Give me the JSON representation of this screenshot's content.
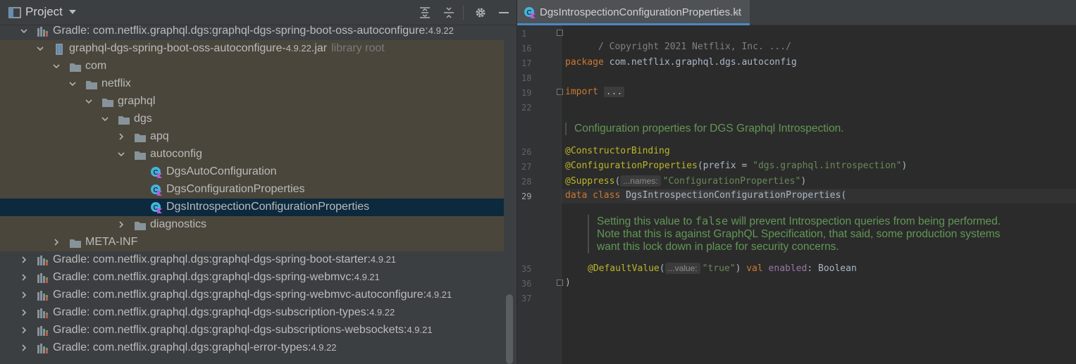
{
  "project": {
    "title": "Project",
    "tree": [
      {
        "label": "Gradle: com.netflix.graphql.dgs:graphql-dgs-spring-boot-oss-autoconfigure:",
        "version": "4.9.22",
        "expanded": true,
        "icon": "library-icon"
      },
      {
        "label": "graphql-dgs-spring-boot-oss-autoconfigure-",
        "version": "4.9.22",
        "suffix": ".jar",
        "hint": "library root",
        "expanded": true,
        "icon": "jar-icon"
      },
      {
        "label": "com",
        "expanded": true,
        "icon": "folder-icon"
      },
      {
        "label": "netflix",
        "expanded": true,
        "icon": "folder-icon"
      },
      {
        "label": "graphql",
        "expanded": true,
        "icon": "folder-icon"
      },
      {
        "label": "dgs",
        "expanded": true,
        "icon": "folder-icon"
      },
      {
        "label": "apq",
        "expanded": false,
        "icon": "folder-icon"
      },
      {
        "label": "autoconfig",
        "expanded": true,
        "icon": "folder-icon"
      },
      {
        "label": "DgsAutoConfiguration",
        "icon": "kotlin-class-icon"
      },
      {
        "label": "DgsConfigurationProperties",
        "icon": "kotlin-class-icon"
      },
      {
        "label": "DgsIntrospectionConfigurationProperties",
        "icon": "kotlin-class-icon",
        "selected": true
      },
      {
        "label": "diagnostics",
        "expanded": false,
        "icon": "folder-icon"
      },
      {
        "label": "META-INF",
        "expanded": false,
        "icon": "folder-icon"
      },
      {
        "label": "Gradle: com.netflix.graphql.dgs:graphql-dgs-spring-boot-starter:",
        "version": "4.9.21",
        "expanded": false,
        "icon": "library-icon"
      },
      {
        "label": "Gradle: com.netflix.graphql.dgs:graphql-dgs-spring-webmvc:",
        "version": "4.9.21",
        "expanded": false,
        "icon": "library-icon"
      },
      {
        "label": "Gradle: com.netflix.graphql.dgs:graphql-dgs-spring-webmvc-autoconfigure:",
        "version": "4.9.21",
        "expanded": false,
        "icon": "library-icon"
      },
      {
        "label": "Gradle: com.netflix.graphql.dgs:graphql-dgs-subscription-types:",
        "version": "4.9.22",
        "expanded": false,
        "icon": "library-icon"
      },
      {
        "label": "Gradle: com.netflix.graphql.dgs:graphql-dgs-subscriptions-websockets:",
        "version": "4.9.21",
        "expanded": false,
        "icon": "library-icon"
      },
      {
        "label": "Gradle: com.netflix.graphql.dgs:graphql-error-types:",
        "version": "4.9.22",
        "expanded": false,
        "icon": "library-icon"
      }
    ]
  },
  "editor": {
    "tab_label": "DgsIntrospectionConfigurationProperties.kt",
    "tab_close": "×",
    "line_numbers": [
      "1",
      "16",
      "17",
      "18",
      "19",
      "22",
      "26",
      "27",
      "28",
      "29",
      "35",
      "36",
      "37"
    ],
    "current_line": "29",
    "code": {
      "copyright": "/ Copyright 2021 Netflix, Inc. .../",
      "package_kw": "package",
      "package_name": " com.netflix.graphql.dgs.autoconfig",
      "import_kw": "import",
      "import_fold": "...",
      "doc1": "Configuration properties for DGS Graphql Introspection.",
      "ann1": "@ConstructorBinding",
      "ann2": "@ConfigurationProperties",
      "ann2_args_open": "(prefix = ",
      "ann2_str": "\"dgs.graphql.introspection\"",
      "ann2_close": ")",
      "ann3": "@Suppress",
      "ann3_open": "(",
      "ann3_hint": "...names:",
      "ann3_str": "\"ConfigurationProperties\"",
      "ann3_close": ")",
      "data_kw": "data class ",
      "class_name": "DgsIntrospectionConfigurationProperties",
      "class_open": "(",
      "doc2_a": "Setting this value to ",
      "doc2_code": "false",
      "doc2_b": " will prevent Introspection queries from being performed.",
      "doc2_line2": "Note that this is against GraphQL Specification, that said, some production systems",
      "doc2_line3": "want this lock down in place for security concerns.",
      "ann4": "@DefaultValue",
      "ann4_open": "(",
      "ann4_hint": "...value:",
      "ann4_str": "\"true\"",
      "ann4_close": ") ",
      "val_kw": "val",
      "prop_name": " enabled",
      "prop_type": ": Boolean",
      "close_paren": ")"
    }
  }
}
